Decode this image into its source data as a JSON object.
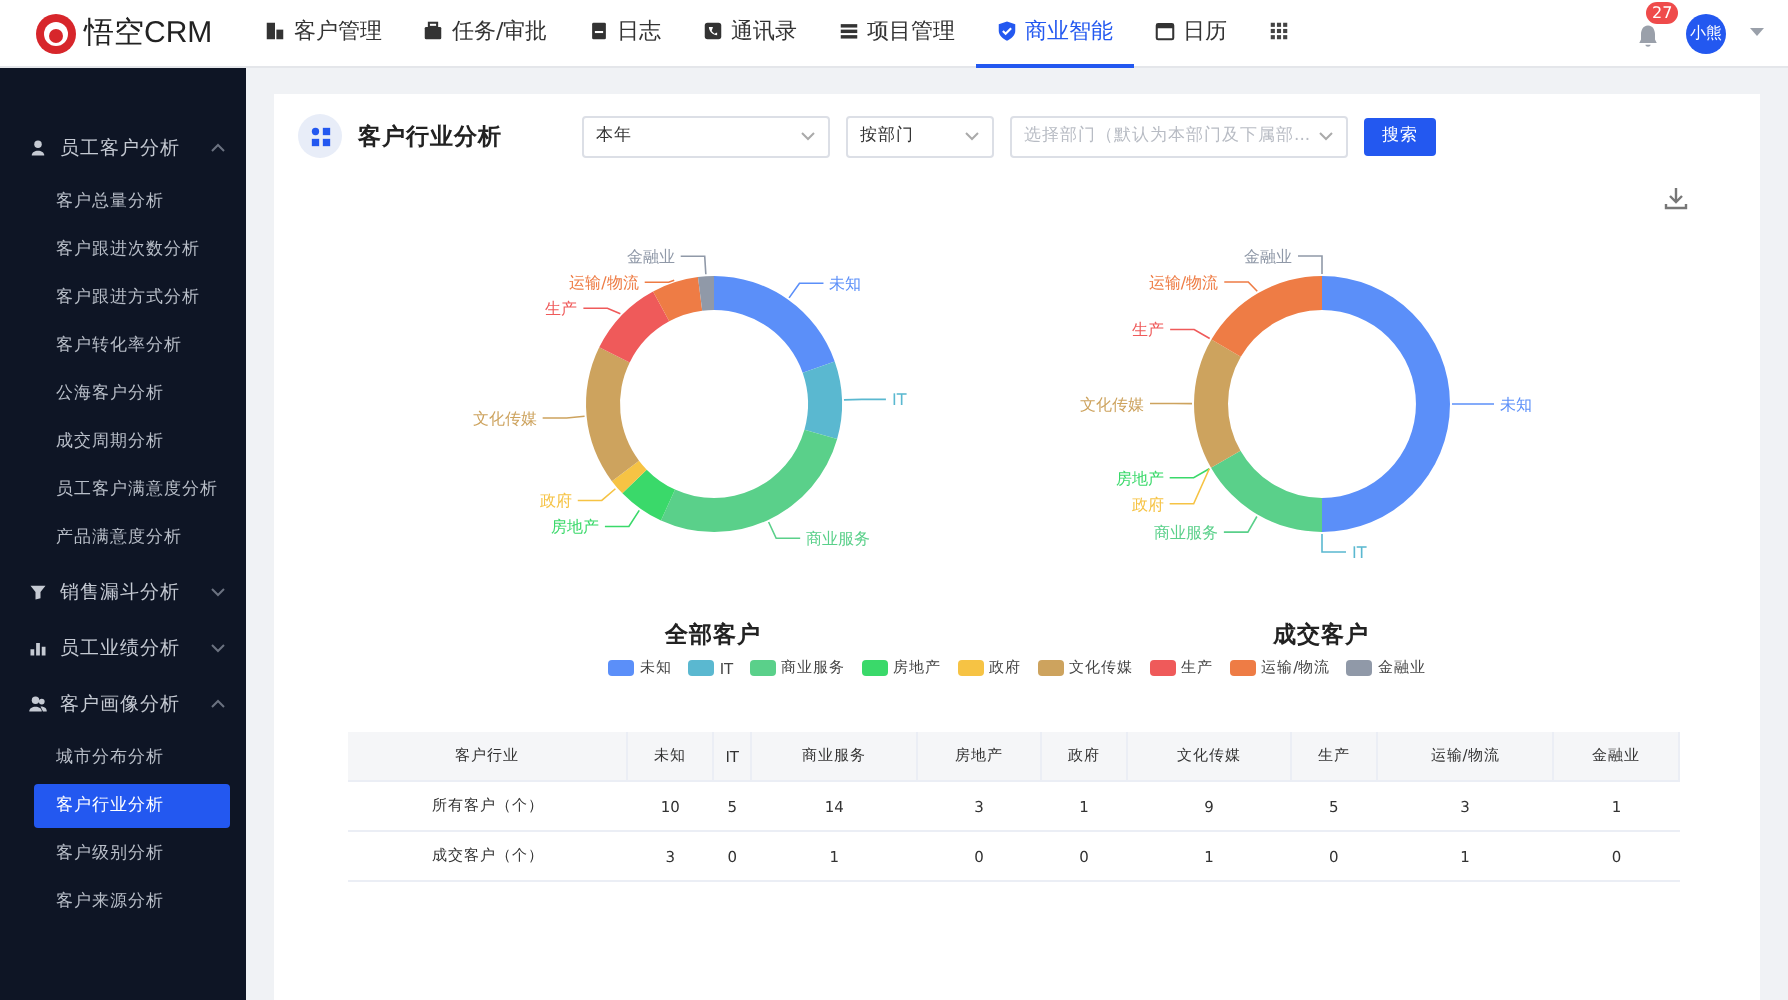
{
  "header": {
    "logo": "悟空CRM",
    "nav": [
      {
        "label": "客户管理",
        "selected": false
      },
      {
        "label": "任务/审批",
        "selected": false
      },
      {
        "label": "日志",
        "selected": false
      },
      {
        "label": "通讯录",
        "selected": false
      },
      {
        "label": "项目管理",
        "selected": false
      },
      {
        "label": "商业智能",
        "selected": true
      },
      {
        "label": "日历",
        "selected": false
      }
    ],
    "notifications": "27",
    "user": "小熊"
  },
  "sidebar": [
    {
      "label": "员工客户分析",
      "expanded": true,
      "children": [
        {
          "label": "客户总量分析",
          "selected": false
        },
        {
          "label": "客户跟进次数分析",
          "selected": false
        },
        {
          "label": "客户跟进方式分析",
          "selected": false
        },
        {
          "label": "客户转化率分析",
          "selected": false
        },
        {
          "label": "公海客户分析",
          "selected": false
        },
        {
          "label": "成交周期分析",
          "selected": false
        },
        {
          "label": "员工客户满意度分析",
          "selected": false
        },
        {
          "label": "产品满意度分析",
          "selected": false
        }
      ]
    },
    {
      "label": "销售漏斗分析",
      "expanded": false
    },
    {
      "label": "员工业绩分析",
      "expanded": false
    },
    {
      "label": "客户画像分析",
      "expanded": true,
      "children": [
        {
          "label": "城市分布分析",
          "selected": false
        },
        {
          "label": "客户行业分析",
          "selected": true
        },
        {
          "label": "客户级别分析",
          "selected": false
        },
        {
          "label": "客户来源分析",
          "selected": false
        }
      ]
    }
  ],
  "page": {
    "title": "客户行业分析",
    "filters": [
      {
        "value": "本年"
      },
      {
        "value": "按部门"
      },
      {
        "placeholder": "选择部门（默认为本部门及下属部..."
      }
    ],
    "search_button": "搜索"
  },
  "legend": [
    {
      "label": "未知",
      "color": "#5b8ff9"
    },
    {
      "label": "IT",
      "color": "#5ab8d0"
    },
    {
      "label": "商业服务",
      "color": "#5ad08a"
    },
    {
      "label": "房地产",
      "color": "#3ad96a"
    },
    {
      "label": "政府",
      "color": "#f6c344"
    },
    {
      "label": "文化传媒",
      "color": "#cda35e"
    },
    {
      "label": "生产",
      "color": "#ef5a5a"
    },
    {
      "label": "运输/物流",
      "color": "#ee7c45"
    },
    {
      "label": "金融业",
      "color": "#9099a8"
    }
  ],
  "charts": [
    {
      "chart_data": {
        "type": "donut",
        "title": "全部客户",
        "categories": [
          "未知",
          "IT",
          "商业服务",
          "房地产",
          "政府",
          "文化传媒",
          "生产",
          "运输/物流",
          "金融业"
        ],
        "values": [
          19.6,
          9.8,
          27.4,
          5.9,
          2.0,
          17.6,
          9.8,
          5.9,
          2.0
        ]
      }
    },
    {
      "chart_data": {
        "type": "donut",
        "title": "成交客户",
        "categories": [
          "未知",
          "IT",
          "商业服务",
          "房地产",
          "政府",
          "文化传媒",
          "生产",
          "运输/物流",
          "金融业"
        ],
        "values": [
          50,
          0,
          16.7,
          0,
          0,
          16.7,
          0,
          16.6,
          0
        ]
      }
    }
  ],
  "table": {
    "columns": [
      "客户行业",
      "未知",
      "IT",
      "商业服务",
      "房地产",
      "政府",
      "文化传媒",
      "生产",
      "运输/物流",
      "金融业"
    ],
    "rows": [
      [
        "所有客户（个）",
        "10",
        "5",
        "14",
        "3",
        "1",
        "9",
        "5",
        "3",
        "1"
      ],
      [
        "成交客户（个）",
        "3",
        "0",
        "1",
        "0",
        "0",
        "1",
        "0",
        "1",
        "0"
      ]
    ]
  }
}
